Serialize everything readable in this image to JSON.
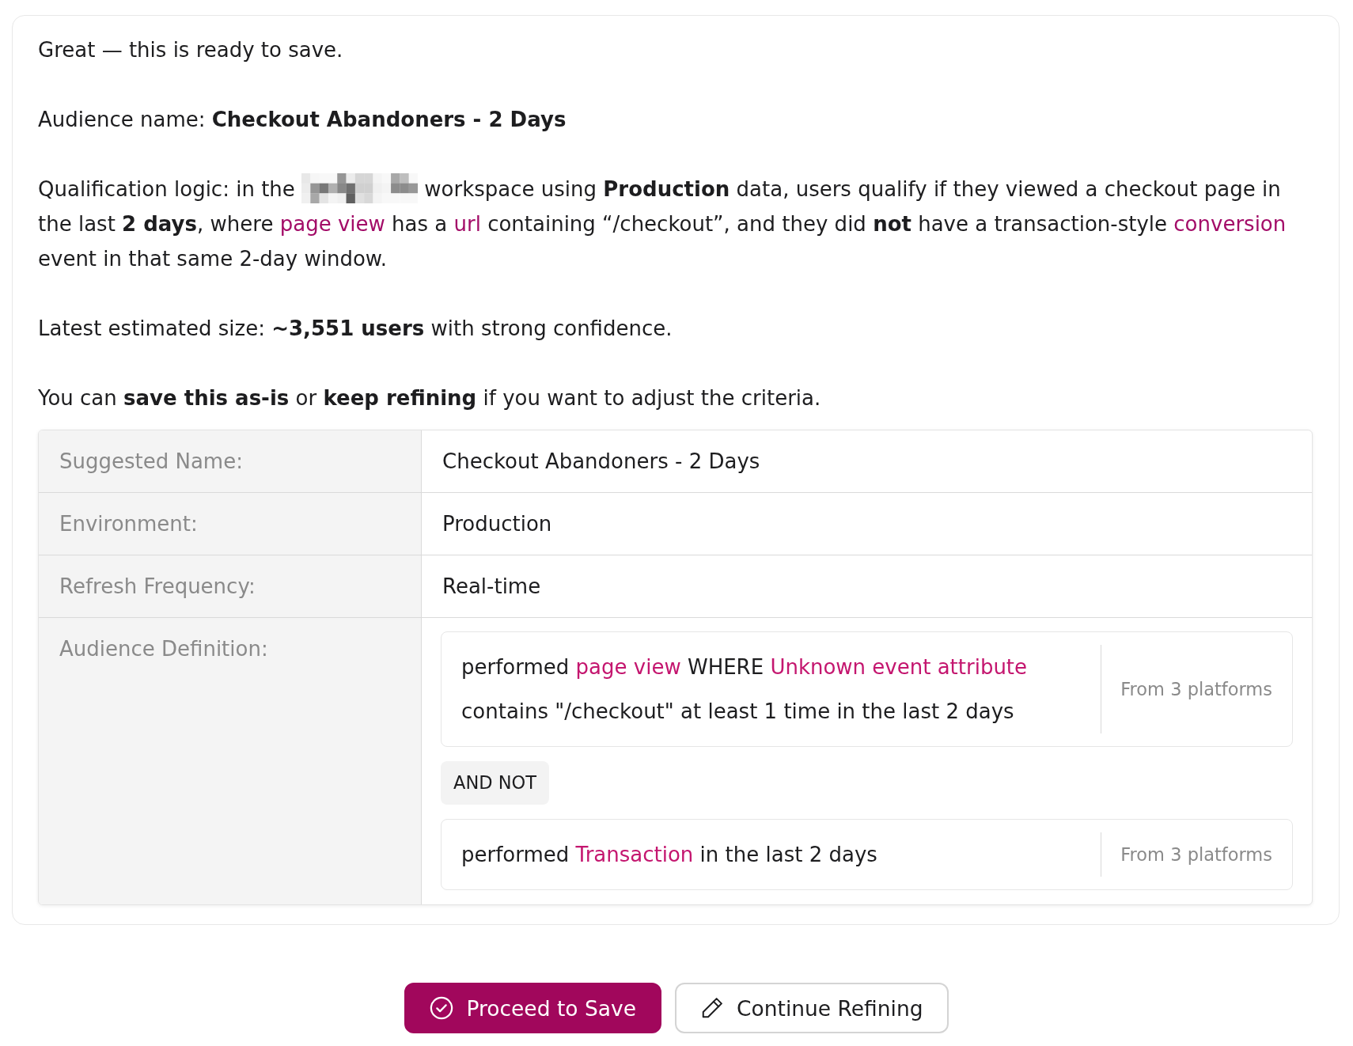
{
  "message": {
    "paragraphs": [
      {
        "segments": [
          {
            "kind": "text",
            "text": "Great — this is ready to save."
          }
        ]
      },
      {
        "segments": [
          {
            "kind": "text",
            "text": "Audience name: **Checkout Abandoners - 2 Days**"
          }
        ]
      },
      {
        "segments": [
          {
            "kind": "text",
            "text": "Qualification logic: in the "
          },
          {
            "kind": "redacted"
          },
          {
            "kind": "text",
            "text": " workspace using **Production** data, users qualify if they viewed a checkout page in the last **2 days**, where "
          },
          {
            "kind": "link",
            "text": "page view"
          },
          {
            "kind": "text",
            "text": " has a "
          },
          {
            "kind": "link",
            "text": "url"
          },
          {
            "kind": "text",
            "text": " containing “/checkout”, and they did **not** have a transaction-style "
          },
          {
            "kind": "link",
            "text": "conversion"
          },
          {
            "kind": "text",
            "text": " event in that same 2-day window."
          }
        ]
      },
      {
        "segments": [
          {
            "kind": "text",
            "text": "Latest estimated size: **~3,551 users** with strong confidence."
          }
        ]
      },
      {
        "segments": [
          {
            "kind": "text",
            "text": "You can **save this as-is** or **keep refining** if you want to adjust the criteria."
          }
        ]
      }
    ]
  },
  "summary_table": {
    "rows": [
      {
        "kind": "text",
        "label": "Suggested Name:",
        "value": "Checkout Abandoners - 2 Days"
      },
      {
        "kind": "text",
        "label": "Environment:",
        "value": "Production"
      },
      {
        "kind": "text",
        "label": "Refresh Frequency:",
        "value": "Real-time"
      },
      {
        "kind": "definition",
        "label": "Audience Definition:",
        "items": [
          {
            "kind": "condition",
            "segments": [
              {
                "kind": "text",
                "text": "performed "
              },
              {
                "kind": "link",
                "text": "page view"
              },
              {
                "kind": "text",
                "text": " WHERE "
              },
              {
                "kind": "link",
                "text": "Unknown event attribute"
              },
              {
                "kind": "text",
                "text": " contains \"/checkout\" at least 1 time in the last 2 days"
              }
            ],
            "source": "From 3 platforms"
          },
          {
            "kind": "operator",
            "text": "AND NOT"
          },
          {
            "kind": "condition",
            "segments": [
              {
                "kind": "text",
                "text": "performed "
              },
              {
                "kind": "link",
                "text": "Transaction"
              },
              {
                "kind": "text",
                "text": " in the last 2 days"
              }
            ],
            "source": "From 3 platforms"
          }
        ]
      }
    ]
  },
  "buttons": [
    {
      "kind": "primary",
      "label": "Proceed to Save"
    },
    {
      "kind": "secondary",
      "label": "Continue Refining"
    }
  ]
}
